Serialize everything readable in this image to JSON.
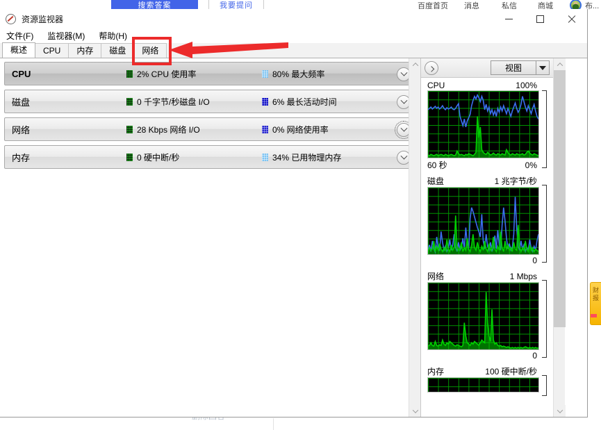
{
  "background_page": {
    "tabs": [
      {
        "label": "搜索答案",
        "active": true
      },
      {
        "label": "我要提问",
        "active": false
      }
    ],
    "nav_links": [
      "百度首页",
      "消息",
      "私信",
      "商城"
    ],
    "user_label": "布...",
    "footer_action": "删除回答",
    "side_widget_text": "财报"
  },
  "window": {
    "title": "资源监视器",
    "icon": "resource-monitor-icon",
    "controls": {
      "minimize": "最小化",
      "maximize": "最大化",
      "close": "关闭"
    }
  },
  "menubar": [
    {
      "label": "文件(F)",
      "text": "文件",
      "accel": "F"
    },
    {
      "label": "监视器(M)",
      "text": "监视器",
      "accel": "M"
    },
    {
      "label": "帮助(H)",
      "text": "帮助",
      "accel": "H"
    }
  ],
  "tabs": [
    {
      "label": "概述",
      "active": true
    },
    {
      "label": "CPU",
      "active": false
    },
    {
      "label": "内存",
      "active": false
    },
    {
      "label": "磁盘",
      "active": false
    },
    {
      "label": "网络",
      "active": false
    }
  ],
  "resource_rows": [
    {
      "name": "CPU",
      "expanded": true,
      "metric1": {
        "value": "2% CPU 使用率",
        "swatch": "green"
      },
      "metric2": {
        "value": "80% 最大频率",
        "swatch": "lightblue"
      },
      "chevron": "chevron-down-icon",
      "focused": false
    },
    {
      "name": "磁盘",
      "expanded": false,
      "metric1": {
        "value": "0 千字节/秒磁盘 I/O",
        "swatch": "green"
      },
      "metric2": {
        "value": "6% 最长活动时间",
        "swatch": "blue"
      },
      "chevron": "chevron-down-icon",
      "focused": false
    },
    {
      "name": "网络",
      "expanded": false,
      "metric1": {
        "value": "28 Kbps 网络 I/O",
        "swatch": "green"
      },
      "metric2": {
        "value": "0% 网络使用率",
        "swatch": "blue2"
      },
      "chevron": "chevron-down-icon",
      "focused": true
    },
    {
      "name": "内存",
      "expanded": false,
      "metric1": {
        "value": "0 硬中断/秒",
        "swatch": "green"
      },
      "metric2": {
        "value": "34% 已用物理内存",
        "swatch": "lightblue"
      },
      "chevron": "chevron-down-icon",
      "focused": false
    }
  ],
  "graph_panel": {
    "collapse_button": "collapse-panel-button",
    "view_label": "视图",
    "view_caret": "chevron-down-icon"
  },
  "annotation": {
    "box_target": "网络",
    "arrow": "left-pointing-arrow",
    "color": "#ec2b2b"
  },
  "colors": {
    "accent_red": "#ec2b2b",
    "graph_background": "#000000",
    "graph_grid": "#00a000",
    "series_green": "#00d000",
    "series_blue": "#3b6ef0",
    "tab_blue": "#4264e8"
  },
  "chart_data": [
    {
      "type": "line",
      "title": "CPU",
      "top_label": "100%",
      "bottom_left_label": "60 秒",
      "bottom_right_label": "0%",
      "ylim": [
        0,
        100
      ],
      "grid": true,
      "legend_position": "none",
      "series": [
        {
          "name": "最大频率",
          "color": "#3b6ef0",
          "values": [
            72,
            74,
            76,
            73,
            75,
            77,
            74,
            76,
            73,
            75,
            78,
            74,
            72,
            75,
            73,
            74,
            76,
            73,
            72,
            74,
            78,
            81,
            62,
            55,
            48,
            58,
            46,
            55,
            60,
            65,
            78,
            86,
            92,
            88,
            94,
            90,
            84,
            92,
            86,
            72,
            80,
            70,
            76,
            66,
            72,
            64,
            70,
            62,
            74,
            68,
            76,
            70,
            78,
            72,
            66,
            74,
            68,
            62,
            70,
            76,
            82,
            74,
            68,
            72,
            80,
            92,
            84,
            76,
            70,
            78,
            72,
            66,
            74,
            80,
            70,
            62,
            58
          ]
        },
        {
          "name": "CPU 使用率",
          "color": "#00d000",
          "values": [
            4,
            3,
            5,
            4,
            3,
            4,
            5,
            3,
            4,
            5,
            4,
            3,
            5,
            4,
            3,
            4,
            5,
            4,
            3,
            4,
            10,
            6,
            4,
            5,
            4,
            3,
            5,
            4,
            6,
            5,
            4,
            3,
            5,
            8,
            62,
            30,
            46,
            12,
            8,
            6,
            5,
            8,
            6,
            4,
            5,
            7,
            5,
            4,
            6,
            5,
            4,
            6,
            5,
            4,
            12,
            8,
            5,
            4,
            6,
            5,
            4,
            6,
            5,
            4,
            5,
            6,
            4,
            5,
            8,
            10,
            7,
            5,
            4,
            6,
            5,
            4,
            3
          ]
        }
      ]
    },
    {
      "type": "line",
      "title": "磁盘",
      "top_label": "1 兆字节/秒",
      "bottom_right_label": "0",
      "ylim": [
        0,
        100
      ],
      "grid": true,
      "legend_position": "none",
      "series": [
        {
          "name": "磁盘 I/O",
          "color": "#3b6ef0",
          "values": [
            6,
            14,
            4,
            20,
            8,
            3,
            26,
            10,
            5,
            34,
            18,
            6,
            12,
            4,
            8,
            22,
            6,
            14,
            30,
            10,
            4,
            18,
            6,
            10,
            24,
            8,
            40,
            16,
            6,
            54,
            70,
            64,
            56,
            48,
            40,
            34,
            26,
            60,
            20,
            8,
            30,
            12,
            6,
            18,
            4,
            10,
            28,
            8,
            36,
            14,
            6,
            44,
            70,
            50,
            24,
            8,
            16,
            6,
            10,
            30,
            86,
            40,
            12,
            6,
            20,
            8,
            14,
            4,
            10,
            6,
            22,
            8,
            4,
            12,
            6,
            20,
            30
          ]
        },
        {
          "name": "最长活动时间",
          "color": "#00d000",
          "values": [
            4,
            10,
            6,
            8,
            20,
            4,
            12,
            6,
            16,
            8,
            4,
            10,
            6,
            22,
            8,
            4,
            14,
            6,
            10,
            58,
            12,
            6,
            8,
            18,
            4,
            10,
            6,
            24,
            8,
            4,
            14,
            30,
            10,
            6,
            18,
            8,
            4,
            12,
            6,
            20,
            8,
            4,
            16,
            6,
            10,
            26,
            8,
            4,
            12,
            6,
            34,
            10,
            4,
            20,
            8,
            14,
            6,
            10,
            4,
            18,
            8,
            6,
            44,
            12,
            4,
            10,
            6,
            20,
            8,
            4,
            14,
            6,
            10,
            4,
            8,
            6,
            4
          ]
        }
      ]
    },
    {
      "type": "area",
      "title": "网络",
      "top_label": "1 Mbps",
      "bottom_right_label": "0",
      "ylim": [
        0,
        100
      ],
      "grid": true,
      "legend_position": "none",
      "series": [
        {
          "name": "网络 I/O",
          "color": "#00d000",
          "values": [
            5,
            6,
            10,
            6,
            5,
            12,
            6,
            5,
            7,
            6,
            14,
            8,
            6,
            10,
            8,
            12,
            10,
            8,
            6,
            5,
            7,
            6,
            5,
            4,
            6,
            40,
            20,
            10,
            8,
            6,
            10,
            8,
            12,
            10,
            8,
            6,
            10,
            14,
            12,
            10,
            86,
            40,
            20,
            12,
            60,
            14,
            8,
            10,
            6,
            5,
            6,
            4,
            5,
            4,
            3,
            4,
            3,
            2,
            3,
            2,
            3,
            2,
            3,
            2,
            3,
            2,
            3,
            4,
            3,
            2,
            3,
            2,
            3,
            2,
            3,
            2,
            2
          ]
        }
      ]
    },
    {
      "type": "line",
      "title": "内存",
      "top_label": "100 硬中断/秒",
      "ylim": [
        0,
        100
      ],
      "grid": true,
      "legend_position": "none",
      "series": [
        {
          "name": "硬中断/秒",
          "color": "#00d000",
          "values": [
            0,
            0,
            0,
            0,
            0,
            0,
            0,
            0,
            0,
            0,
            0,
            0,
            0,
            0,
            0,
            0,
            0,
            0,
            0,
            0
          ]
        }
      ]
    }
  ]
}
